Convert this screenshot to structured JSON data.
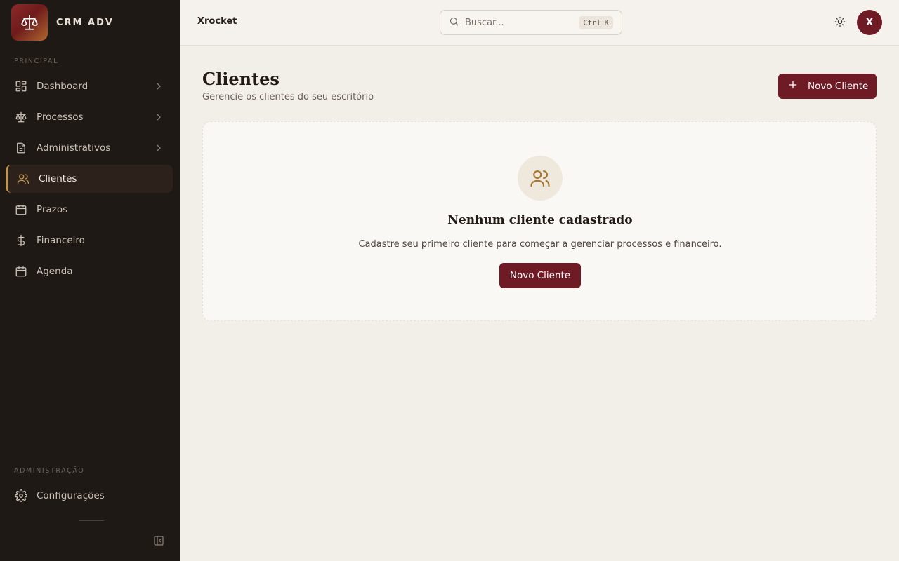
{
  "brand": {
    "name": "CRM ADV"
  },
  "sidebar": {
    "section_principal": "PRINCIPAL",
    "items": [
      {
        "label": "Dashboard",
        "icon": "dashboard-icon"
      },
      {
        "label": "Processos",
        "icon": "scale-icon"
      },
      {
        "label": "Administrativos",
        "icon": "document-icon"
      },
      {
        "label": "Clientes",
        "icon": "users-icon",
        "active": true
      },
      {
        "label": "Prazos",
        "icon": "calendar-icon"
      },
      {
        "label": "Financeiro",
        "icon": "dollar-icon"
      },
      {
        "label": "Agenda",
        "icon": "calendar-grid-icon"
      }
    ],
    "section_admin": "ADMINISTRAÇÃO",
    "admin_items": [
      {
        "label": "Configurações",
        "icon": "gear-icon"
      }
    ]
  },
  "topbar": {
    "workspace": "Xrocket",
    "search_placeholder": "Buscar...",
    "shortcut_ctrl": "Ctrl",
    "shortcut_key": "K",
    "avatar_initial": "X"
  },
  "main": {
    "title": "Clientes",
    "subtitle": "Gerencie os clientes do seu escritório",
    "new_button": "Novo Cliente",
    "empty": {
      "title": "Nenhum cliente cadastrado",
      "description": "Cadastre seu primeiro cliente para começar a gerenciar processos e financeiro.",
      "button": "Novo Cliente"
    }
  },
  "colors": {
    "sidebar_bg": "#1f1915",
    "accent": "#6e1b25",
    "active_border": "#c2954d",
    "page_bg": "#f2eee8"
  }
}
